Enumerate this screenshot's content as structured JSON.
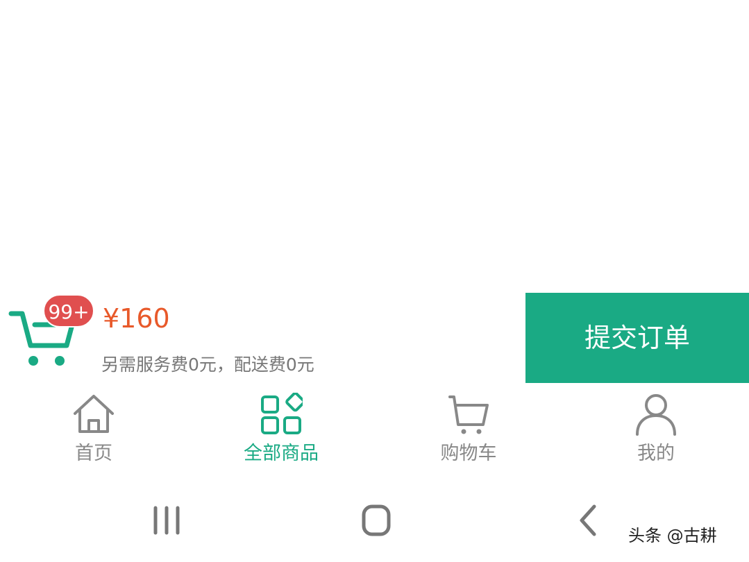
{
  "colors": {
    "accent": "#1aaa84",
    "price": "#e8592a",
    "badge": "#e04f4f",
    "inactive": "#888888"
  },
  "cart_summary": {
    "badge_count": "99+",
    "price": "¥160",
    "fee_note": "另需服务费0元，配送费0元",
    "submit_label": "提交订单"
  },
  "tab_bar": {
    "tabs": [
      {
        "label": "首页",
        "icon": "home-icon",
        "active": false
      },
      {
        "label": "全部商品",
        "icon": "grid-icon",
        "active": true
      },
      {
        "label": "购物车",
        "icon": "cart-icon",
        "active": false
      },
      {
        "label": "我的",
        "icon": "user-icon",
        "active": false
      }
    ]
  },
  "system_nav": {
    "buttons": [
      "recent-apps-icon",
      "home-button-icon",
      "back-icon"
    ]
  },
  "watermark": {
    "text": "头条 @古耕"
  }
}
